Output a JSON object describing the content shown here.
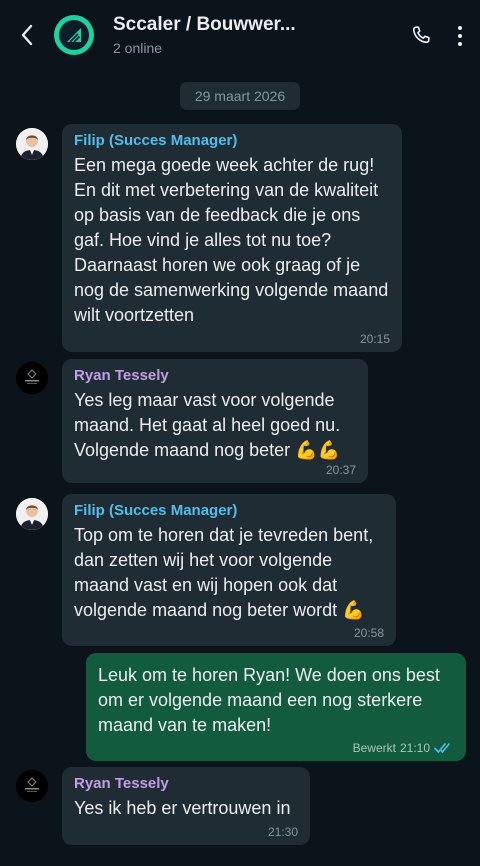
{
  "header": {
    "title": "Sccaler / Bouwwer...",
    "subtitle": "2 online"
  },
  "date_separator": "29 maart 2026",
  "messages": [
    {
      "sender": "Filip (Succes Manager)",
      "text": "Een mega goede week achter de rug! En dit met verbetering van de kwaliteit op basis van de feedback die je ons gaf. Hoe vind je alles tot nu toe? Daarnaast horen we ook graag of je nog de samenwerking volgende maand wilt voortzetten",
      "time": "20:15"
    },
    {
      "sender": "Ryan Tessely",
      "text": "Yes leg maar vast voor volgende maand. Het gaat al heel goed nu. Volgende maand nog beter 💪💪",
      "time": "20:37"
    },
    {
      "sender": "Filip (Succes Manager)",
      "text": "Top om te horen dat je tevreden bent, dan zetten wij het voor volgende maand vast en wij hopen ook dat volgende maand nog beter wordt 💪",
      "time": "20:58"
    },
    {
      "text": "Leuk om te horen Ryan! We doen ons best om er volgende maand een nog sterkere maand van te maken!",
      "edited_label": "Bewerkt",
      "time": "21:10",
      "status": "read"
    },
    {
      "sender": "Ryan Tessely",
      "text": "Yes ik heb er vertrouwen in",
      "time": "21:30"
    }
  ],
  "icons": {
    "back": "chevron-left-icon",
    "call": "phone-icon",
    "menu": "more-vertical-icon",
    "read_receipt": "double-check-icon"
  },
  "colors": {
    "background": "#0b141a",
    "incoming_bubble": "#202c33",
    "outgoing_bubble": "#135b3f",
    "filip_name": "#53bdeb",
    "ryan_name": "#c39ce8",
    "read_tick": "#53bdeb",
    "group_avatar": "#1fd0a0"
  }
}
